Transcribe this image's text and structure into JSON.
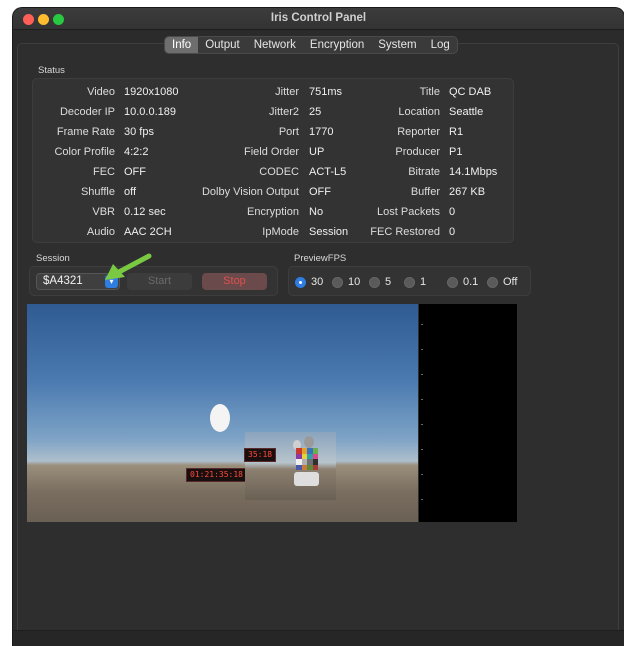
{
  "window": {
    "title": "Iris Control Panel"
  },
  "tabs": [
    "Info",
    "Output",
    "Network",
    "Encryption",
    "System",
    "Log"
  ],
  "status": {
    "label": "Status",
    "col1": [
      {
        "label": "Video",
        "value": "1920x1080"
      },
      {
        "label": "Decoder IP",
        "value": "10.0.0.189"
      },
      {
        "label": "Frame Rate",
        "value": "30 fps"
      },
      {
        "label": "Color Profile",
        "value": "4:2:2"
      },
      {
        "label": "FEC",
        "value": "OFF"
      },
      {
        "label": "Shuffle",
        "value": "off"
      },
      {
        "label": "VBR",
        "value": "0.12 sec"
      },
      {
        "label": "Audio",
        "value": "AAC 2CH"
      }
    ],
    "col2": [
      {
        "label": "Jitter",
        "value": "751ms"
      },
      {
        "label": "Jitter2",
        "value": "25"
      },
      {
        "label": "Port",
        "value": "1770"
      },
      {
        "label": "Field Order",
        "value": "UP"
      },
      {
        "label": "CODEC",
        "value": "ACT-L5"
      },
      {
        "label": "Dolby Vision Output",
        "value": "OFF"
      },
      {
        "label": "Encryption",
        "value": "No"
      },
      {
        "label": "IpMode",
        "value": "Session"
      }
    ],
    "col3": [
      {
        "label": "Title",
        "value": "QC DAB"
      },
      {
        "label": "Location",
        "value": "Seattle"
      },
      {
        "label": "Reporter",
        "value": "R1"
      },
      {
        "label": "Producer",
        "value": "P1"
      },
      {
        "label": "Bitrate",
        "value": "14.1Mbps"
      },
      {
        "label": "Buffer",
        "value": "267 KB"
      },
      {
        "label": "Lost Packets",
        "value": "0"
      },
      {
        "label": "FEC Restored",
        "value": "0"
      }
    ]
  },
  "session": {
    "label": "Session",
    "selected": "$A4321",
    "start_label": "Start",
    "stop_label": "Stop"
  },
  "preview_fps": {
    "label": "PreviewFPS",
    "options": [
      "30",
      "10",
      "5",
      "1",
      "0.1",
      "Off"
    ],
    "selected": "30"
  },
  "preview": {
    "timestamp_main": "01:21:35:18",
    "timestamp_inner": "35:18"
  },
  "colors": {
    "accent": "#2f7de1",
    "stop": "#e05050",
    "annotation_arrow": "#7ac943"
  },
  "icons": {
    "dropdown": "chevron-down-icon",
    "annotation": "arrow-annotation-icon"
  }
}
